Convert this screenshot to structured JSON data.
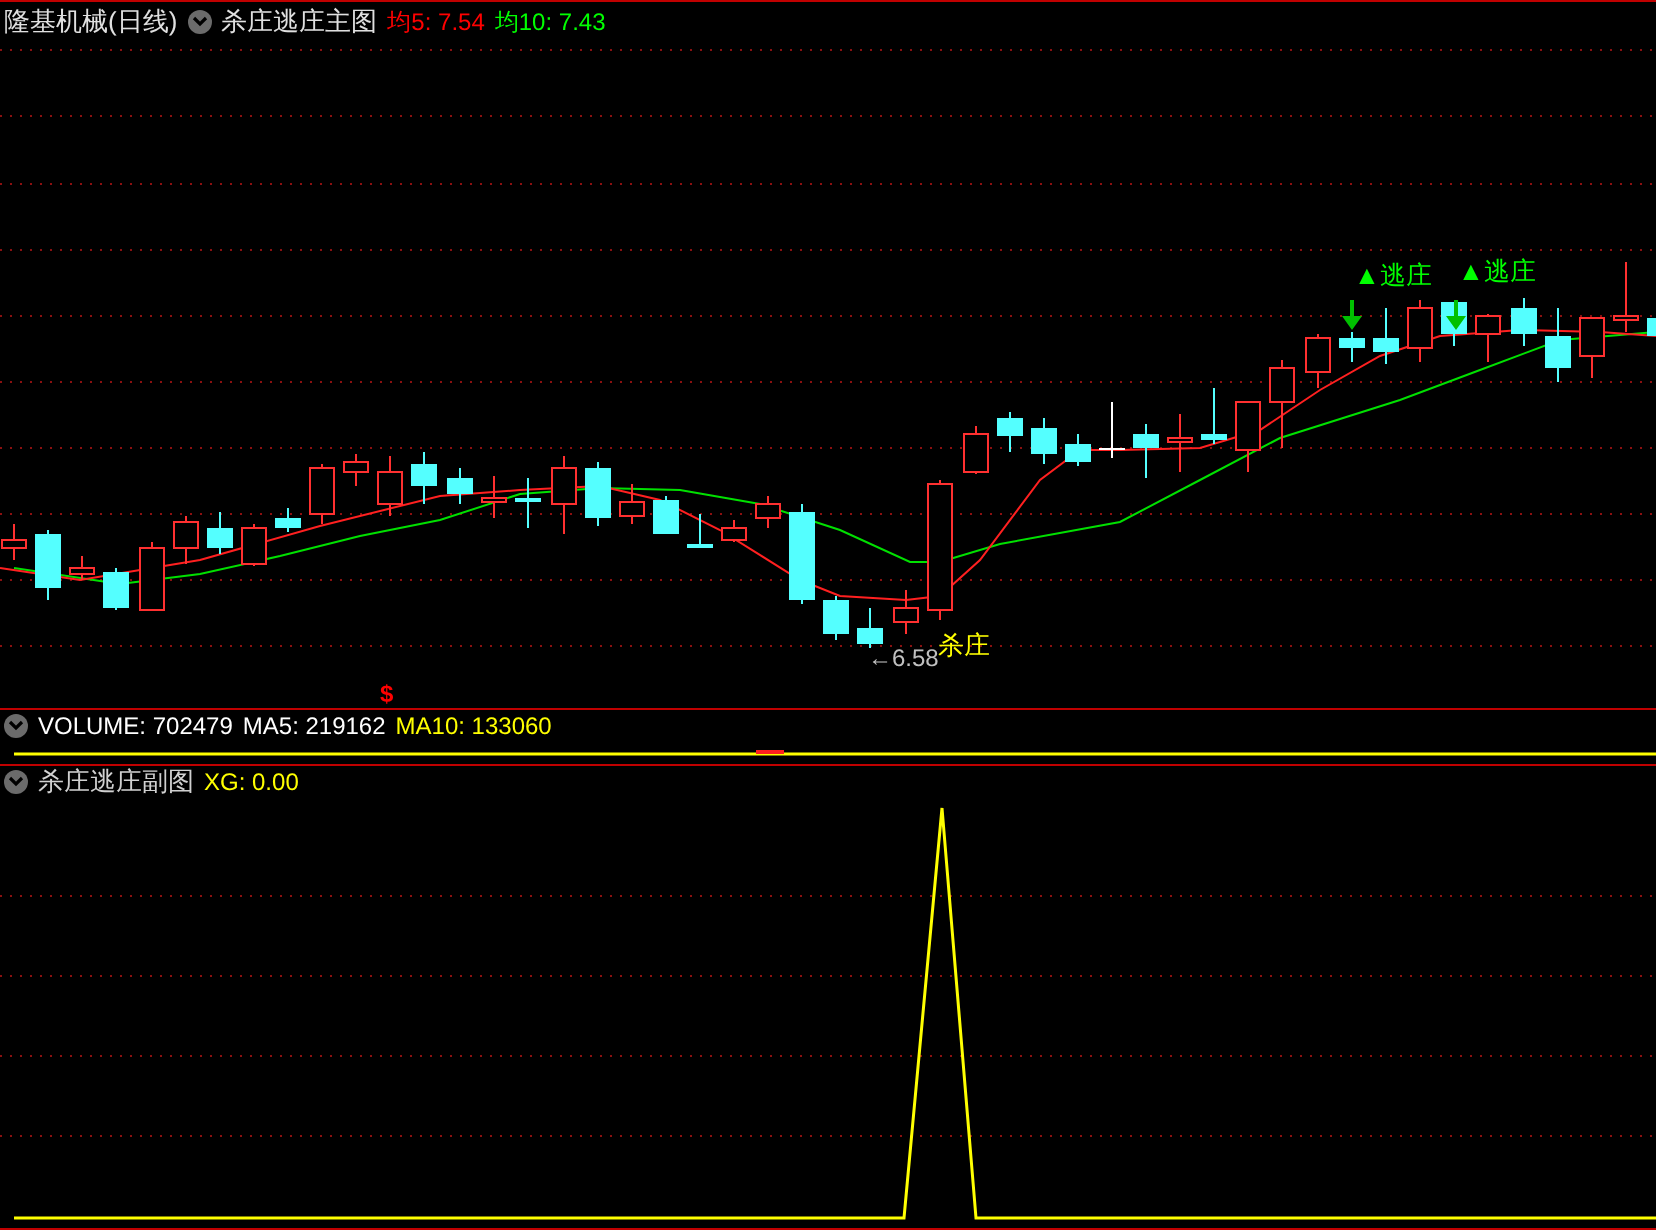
{
  "header": {
    "title": "隆基机械(日线)",
    "indicator": "杀庄逃庄主图",
    "ma_values": [
      {
        "label": "均5: 7.54",
        "color": "#ff0000"
      },
      {
        "label": "均10: 7.43",
        "color": "#00ff00"
      }
    ]
  },
  "main_chart": {
    "markers": [
      {
        "kind": "escape",
        "text": "▲逃庄"
      },
      {
        "kind": "escape",
        "text": "▲逃庄"
      },
      {
        "kind": "kill",
        "text": "杀庄"
      },
      {
        "kind": "low",
        "text": "←6.58"
      },
      {
        "kind": "dollar",
        "text": "$"
      }
    ]
  },
  "volume_panel": {
    "indicator": "VOLUME: 702479",
    "values": [
      {
        "label": "MA5: 219162",
        "color": "#ffffff"
      },
      {
        "label": "MA10: 133060",
        "color": "#ffff00"
      }
    ]
  },
  "sub_panel": {
    "indicator": "杀庄逃庄副图",
    "values": [
      {
        "label": "XG: 0.00",
        "color": "#ffff00"
      }
    ]
  }
}
